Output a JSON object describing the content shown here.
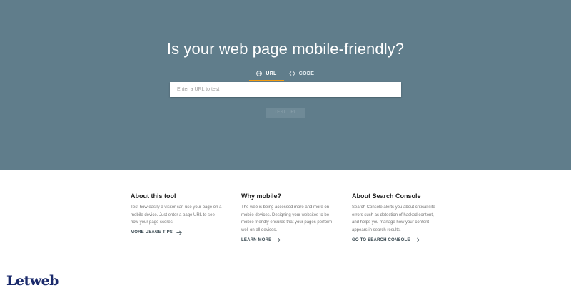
{
  "hero": {
    "title": "Is your web page mobile-friendly?",
    "tabs": [
      {
        "label": "URL",
        "icon": "globe-icon",
        "active": true
      },
      {
        "label": "CODE",
        "icon": "code-icon",
        "active": false
      }
    ],
    "input_placeholder": "Enter a URL to test",
    "input_value": "",
    "test_button": "TEST URL",
    "background_color": "#607d8b",
    "accent_color": "#f39c12"
  },
  "info": [
    {
      "heading": "About this tool",
      "body": "Test how easily a visitor can use your page on a mobile device. Just enter a page URL to see how your page scores.",
      "link": "MORE USAGE TIPS"
    },
    {
      "heading": "Why mobile?",
      "body": "The web is being accessed more and more on mobile devices. Designing your websites to be mobile friendly ensures that your pages perform well on all devices.",
      "link": "LEARN MORE"
    },
    {
      "heading": "About Search Console",
      "body": "Search Console alerts you about critical site errors such as detection of hacked content, and helps you manage how your content appears in search results.",
      "link": "GO TO SEARCH CONSOLE"
    }
  ],
  "watermark": {
    "text": "Letweb"
  }
}
